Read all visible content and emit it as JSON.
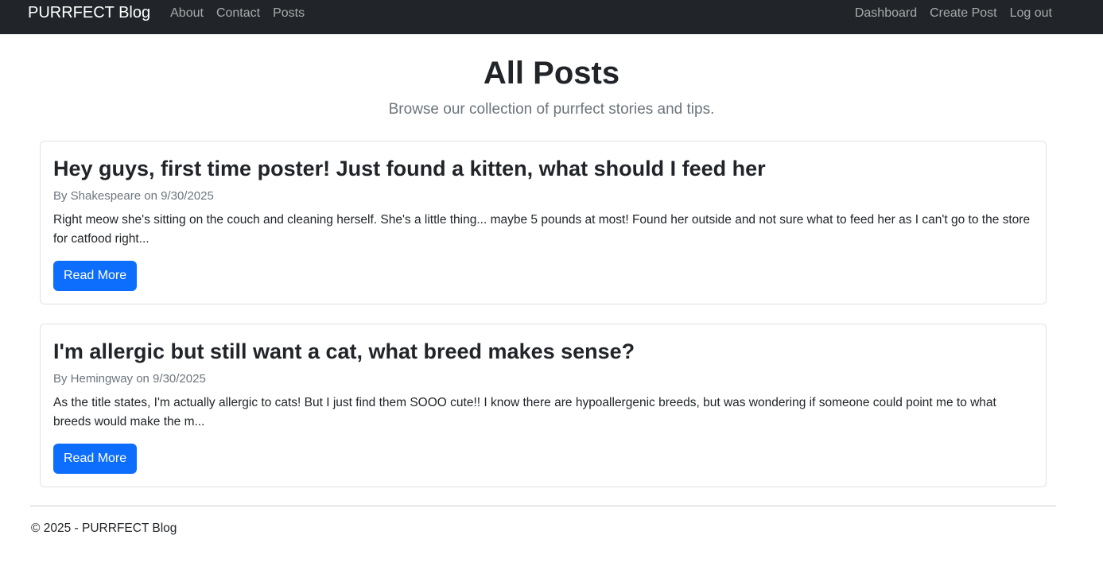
{
  "nav": {
    "brand": "PURRFECT Blog",
    "left_links": [
      "About",
      "Contact",
      "Posts"
    ],
    "right_links": [
      "Dashboard",
      "Create Post",
      "Log out"
    ]
  },
  "page": {
    "title": "All Posts",
    "subtitle": "Browse our collection of purrfect stories and tips."
  },
  "posts": [
    {
      "title": "Hey guys, first time poster! Just found a kitten, what should I feed her",
      "meta": "By Shakespeare on 9/30/2025",
      "excerpt": "Right meow she's sitting on the couch and cleaning herself. She's a little thing... maybe 5 pounds at most! Found her outside and not sure what to feed her as I can't go to the store for catfood right...",
      "button": "Read More"
    },
    {
      "title": "I'm allergic but still want a cat, what breed makes sense?",
      "meta": "By Hemingway on 9/30/2025",
      "excerpt": "As the title states, I'm actually allergic to cats! But I just find them SOOO cute!! I know there are hypoallergenic breeds, but was wondering if someone could point me to what breeds would make the m...",
      "button": "Read More"
    }
  ],
  "footer": {
    "text": "© 2025 - PURRFECT Blog"
  },
  "colors": {
    "navbar_bg": "#212529",
    "primary": "#0d6efd",
    "muted": "#6c757d",
    "border": "#dee2e6"
  }
}
